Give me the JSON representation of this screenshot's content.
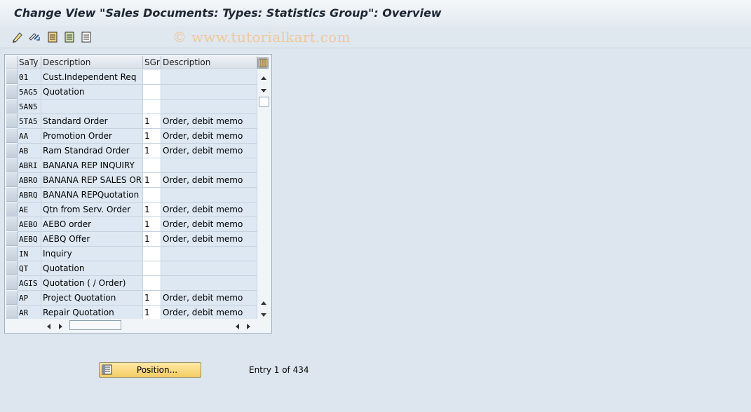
{
  "window": {
    "title": "Change View \"Sales Documents: Types: Statistics Group\": Overview"
  },
  "toolbar": {
    "buttons": [
      "edit-icon",
      "other-view-icon",
      "select-all-icon",
      "select-block-icon",
      "deselect-all-icon"
    ],
    "watermark": "© www.tutorialkart.com"
  },
  "table": {
    "columns": [
      "SaTy",
      "Description",
      "SGr",
      "Description"
    ],
    "rows": [
      {
        "saty": "01",
        "description": "Cust.Independent Req",
        "sgr": "",
        "sgr_description": ""
      },
      {
        "saty": "5AG5",
        "description": "Quotation",
        "sgr": "",
        "sgr_description": ""
      },
      {
        "saty": "5AN5",
        "description": "",
        "sgr": "",
        "sgr_description": ""
      },
      {
        "saty": "5TA5",
        "description": "Standard Order",
        "sgr": "1",
        "sgr_description": "Order, debit memo"
      },
      {
        "saty": "AA",
        "description": "Promotion Order",
        "sgr": "1",
        "sgr_description": "Order, debit memo"
      },
      {
        "saty": "AB",
        "description": "Ram Standrad Order",
        "sgr": "1",
        "sgr_description": "Order, debit memo"
      },
      {
        "saty": "ABRI",
        "description": "BANANA REP INQUIRY",
        "sgr": "",
        "sgr_description": ""
      },
      {
        "saty": "ABRO",
        "description": "BANANA REP SALES ORD",
        "sgr": "1",
        "sgr_description": "Order, debit memo"
      },
      {
        "saty": "ABRQ",
        "description": "BANANA REPQuotation",
        "sgr": "",
        "sgr_description": ""
      },
      {
        "saty": "AE",
        "description": "Qtn from Serv. Order",
        "sgr": "1",
        "sgr_description": "Order, debit memo"
      },
      {
        "saty": "AEBO",
        "description": "AEBO order",
        "sgr": "1",
        "sgr_description": "Order, debit memo"
      },
      {
        "saty": "AEBQ",
        "description": "AEBQ Offer",
        "sgr": "1",
        "sgr_description": "Order, debit memo"
      },
      {
        "saty": "IN",
        "description": "Inquiry",
        "sgr": "",
        "sgr_description": ""
      },
      {
        "saty": "QT",
        "description": "Quotation",
        "sgr": "",
        "sgr_description": ""
      },
      {
        "saty": "AGIS",
        "description": "Quotation ( / Order)",
        "sgr": "",
        "sgr_description": ""
      },
      {
        "saty": "AP",
        "description": "Project Quotation",
        "sgr": "1",
        "sgr_description": "Order, debit memo"
      },
      {
        "saty": "AR",
        "description": "Repair Quotation",
        "sgr": "1",
        "sgr_description": "Order, debit memo"
      }
    ]
  },
  "footer": {
    "position_button": "Position...",
    "entry_text": "Entry 1 of 434"
  }
}
